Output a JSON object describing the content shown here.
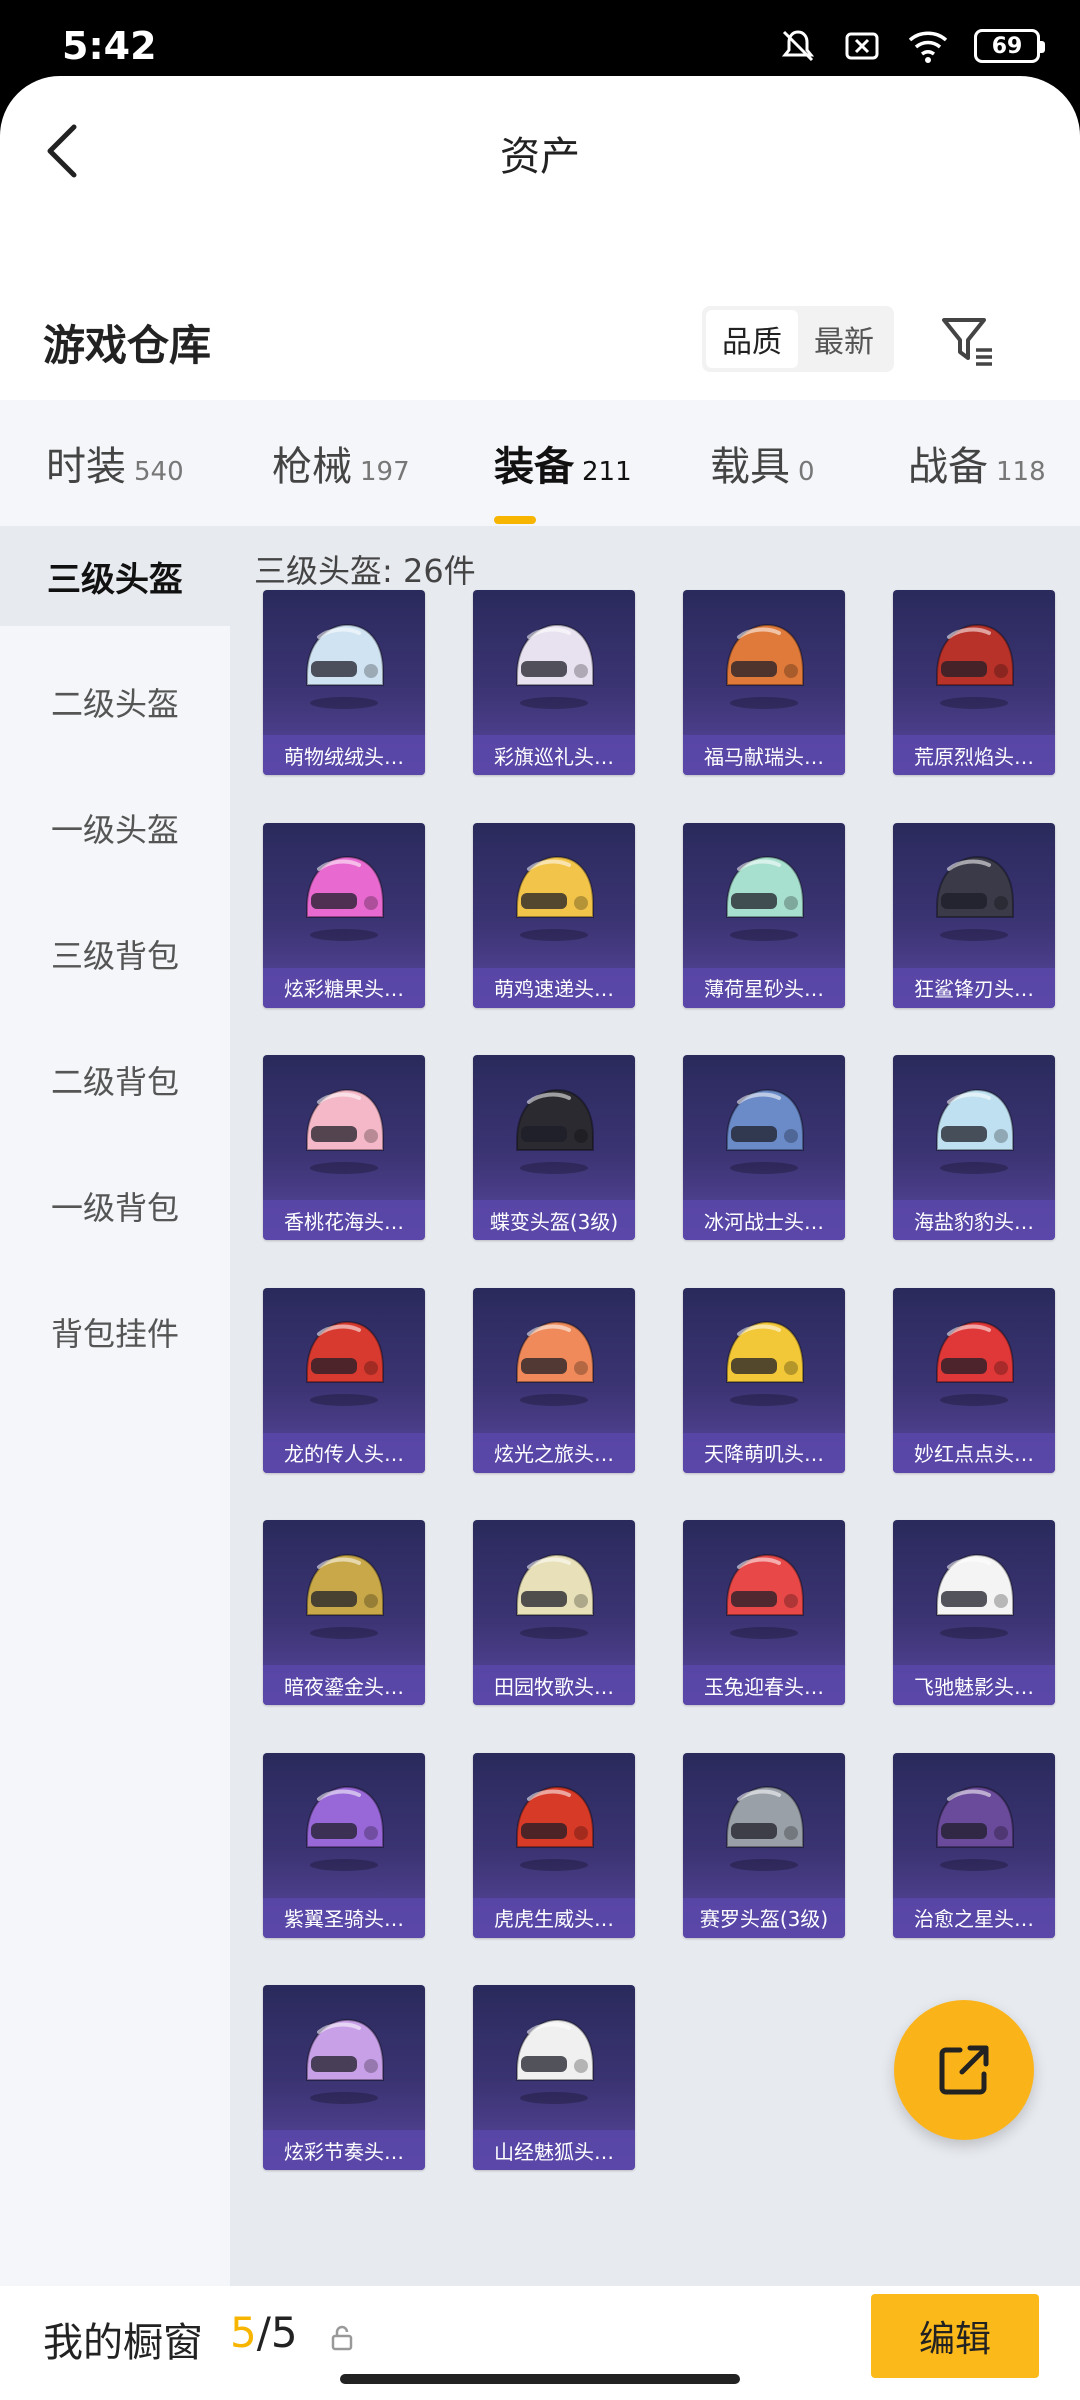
{
  "status": {
    "time": "5:42",
    "battery": "69"
  },
  "nav": {
    "title": "资产"
  },
  "section": {
    "title": "游戏仓库",
    "sort_options": [
      "品质",
      "最新"
    ]
  },
  "tabs": [
    {
      "label": "时装",
      "count": "540"
    },
    {
      "label": "枪械",
      "count": "197"
    },
    {
      "label": "装备",
      "count": "211"
    },
    {
      "label": "载具",
      "count": "0"
    },
    {
      "label": "战备",
      "count": "118"
    }
  ],
  "sidebar": [
    "三级头盔",
    "二级头盔",
    "一级头盔",
    "三级背包",
    "二级背包",
    "一级背包",
    "背包挂件"
  ],
  "content": {
    "title": "三级头盔: 26件",
    "items": [
      "萌物绒绒头…",
      "彩旗巡礼头…",
      "福马献瑞头…",
      "荒原烈焰头…",
      "炫彩糖果头…",
      "萌鸡速递头…",
      "薄荷星砂头…",
      "狂鲨锋刃头…",
      "香桃花海头…",
      "蝶变头盔(3级)",
      "冰河战士头…",
      "海盐豹豹头…",
      "龙的传人头…",
      "炫光之旅头…",
      "天降萌叽头…",
      "妙红点点头…",
      "暗夜鎏金头…",
      "田园牧歌头…",
      "玉兔迎春头…",
      "飞驰魅影头…",
      "紫翼圣骑头…",
      "虎虎生威头…",
      "赛罗头盔(3级)",
      "治愈之星头…",
      "炫彩节奏头…",
      "山经魅狐头…"
    ]
  },
  "bottom": {
    "showcase_label": "我的橱窗",
    "current": "5",
    "total": "/5",
    "edit_label": "编辑"
  },
  "colors": {
    "accent": "#f7b500",
    "card_bg": "#3c3474",
    "card_label": "#5a48aa"
  }
}
